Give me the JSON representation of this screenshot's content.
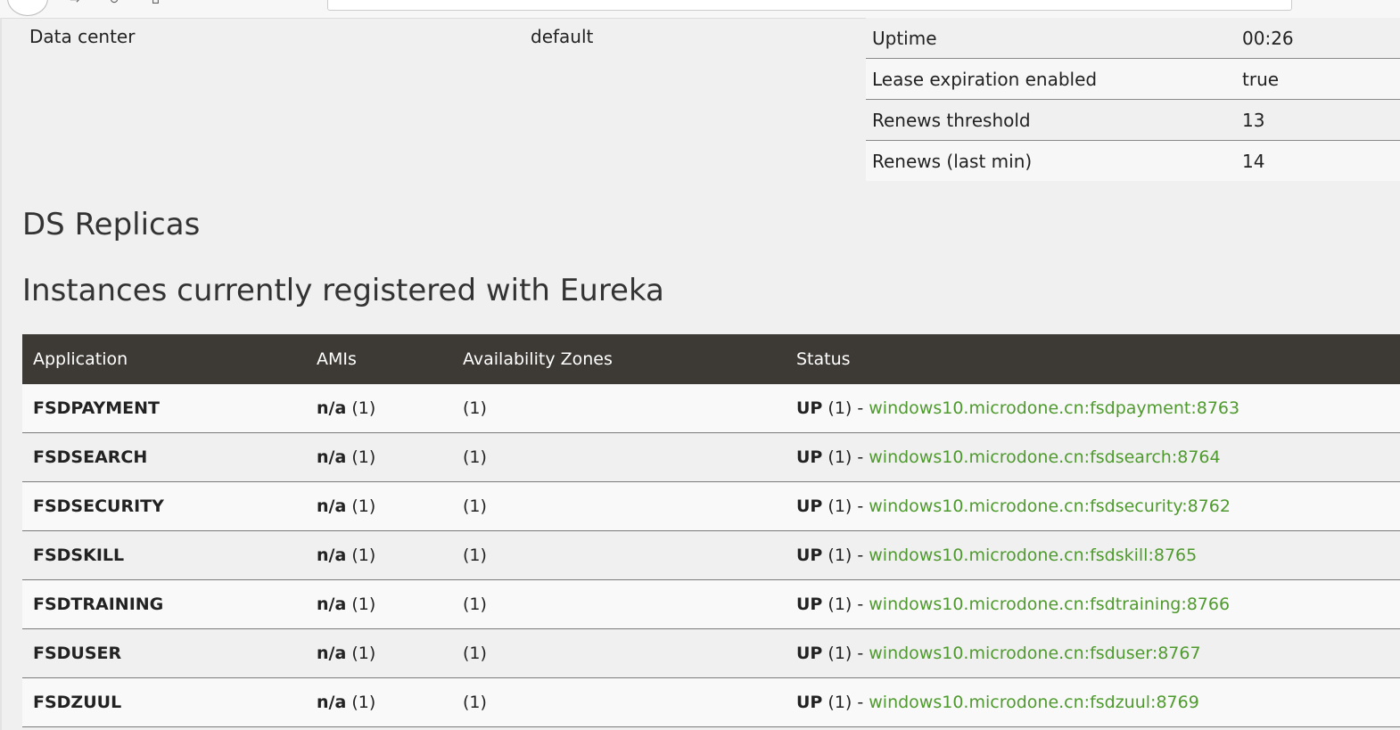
{
  "system": {
    "data_center_label": "Data center",
    "data_center_value": "default"
  },
  "stats": [
    {
      "label": "Uptime",
      "value": "00:26"
    },
    {
      "label": "Lease expiration enabled",
      "value": "true"
    },
    {
      "label": "Renews threshold",
      "value": "13"
    },
    {
      "label": "Renews (last min)",
      "value": "14"
    }
  ],
  "headings": {
    "replicas": "DS Replicas",
    "instances": "Instances currently registered with Eureka"
  },
  "table": {
    "headers": [
      "Application",
      "AMIs",
      "Availability Zones",
      "Status"
    ],
    "rows": [
      {
        "app": "FSDPAYMENT",
        "ami_bold": "n/a",
        "ami_count": "(1)",
        "zones": "(1)",
        "status": "UP",
        "status_count": "(1) -",
        "instance": "windows10.microdone.cn:fsdpayment:8763"
      },
      {
        "app": "FSDSEARCH",
        "ami_bold": "n/a",
        "ami_count": "(1)",
        "zones": "(1)",
        "status": "UP",
        "status_count": "(1) -",
        "instance": "windows10.microdone.cn:fsdsearch:8764"
      },
      {
        "app": "FSDSECURITY",
        "ami_bold": "n/a",
        "ami_count": "(1)",
        "zones": "(1)",
        "status": "UP",
        "status_count": "(1) -",
        "instance": "windows10.microdone.cn:fsdsecurity:8762"
      },
      {
        "app": "FSDSKILL",
        "ami_bold": "n/a",
        "ami_count": "(1)",
        "zones": "(1)",
        "status": "UP",
        "status_count": "(1) -",
        "instance": "windows10.microdone.cn:fsdskill:8765"
      },
      {
        "app": "FSDTRAINING",
        "ami_bold": "n/a",
        "ami_count": "(1)",
        "zones": "(1)",
        "status": "UP",
        "status_count": "(1) -",
        "instance": "windows10.microdone.cn:fsdtraining:8766"
      },
      {
        "app": "FSDUSER",
        "ami_bold": "n/a",
        "ami_count": "(1)",
        "zones": "(1)",
        "status": "UP",
        "status_count": "(1) -",
        "instance": "windows10.microdone.cn:fsduser:8767"
      },
      {
        "app": "FSDZUUL",
        "ami_bold": "n/a",
        "ami_count": "(1)",
        "zones": "(1)",
        "status": "UP",
        "status_count": "(1) -",
        "instance": "windows10.microdone.cn:fsdzuul:8769"
      }
    ]
  },
  "colors": {
    "header_bg": "#3d3934",
    "link": "#4f9a2e",
    "page_bg": "#f0f0f0"
  },
  "icons": [
    "back-icon",
    "forward-icon",
    "reload-icon",
    "home-icon"
  ]
}
